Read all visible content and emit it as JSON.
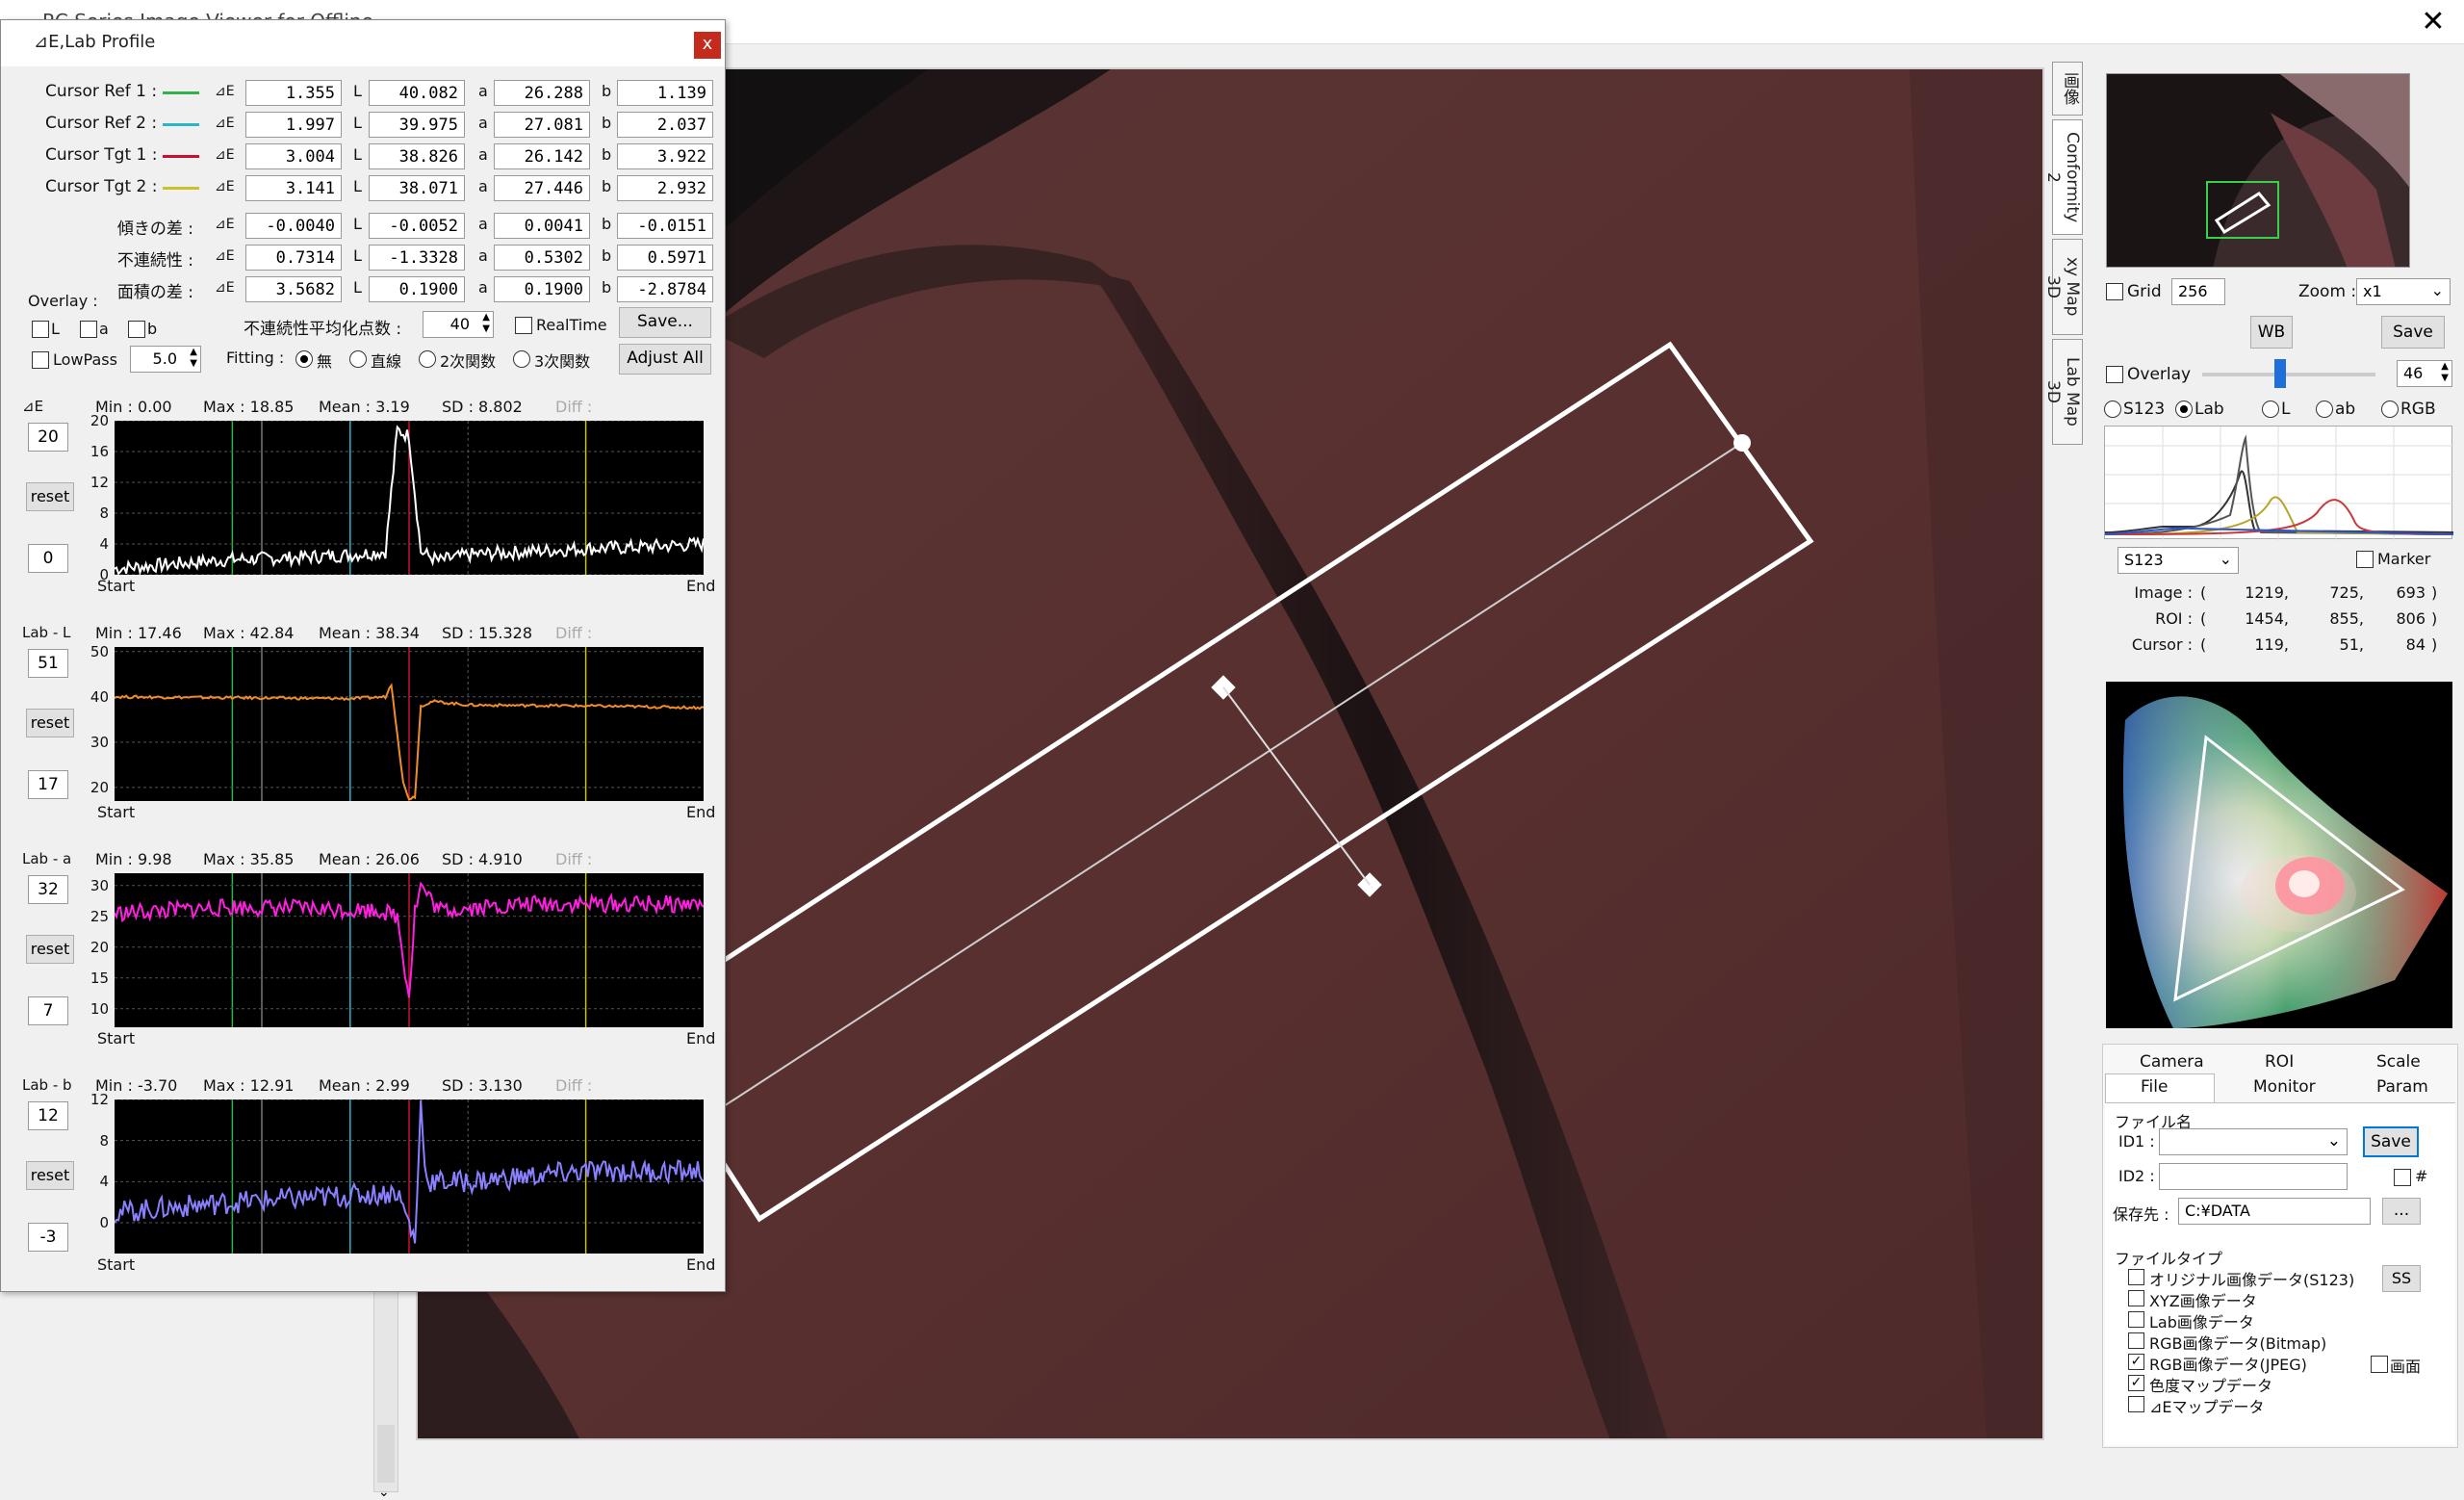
{
  "app": {
    "title": "RC Series Image Viewer for Offline ..."
  },
  "profile": {
    "title": "⊿E,Lab Profile",
    "close_label": "x",
    "cursors": [
      {
        "label": "Cursor Ref 1 :",
        "color": "#2fb24a",
        "dE_label": "⊿E",
        "dE": "1.355",
        "L": "40.082",
        "a": "26.288",
        "b": "1.139"
      },
      {
        "label": "Cursor Ref 2 :",
        "color": "#2bb5c8",
        "dE_label": "⊿E",
        "dE": "1.997",
        "L": "39.975",
        "a": "27.081",
        "b": "2.037"
      },
      {
        "label": "Cursor Tgt 1 :",
        "color": "#c8102e",
        "dE_label": "⊿E",
        "dE": "3.004",
        "L": "38.826",
        "a": "26.142",
        "b": "3.922"
      },
      {
        "label": "Cursor Tgt 2 :",
        "color": "#c9c227",
        "dE_label": "⊿E",
        "dE": "3.141",
        "L": "38.071",
        "a": "27.446",
        "b": "2.932"
      }
    ],
    "diffs": [
      {
        "label": "傾きの差 :",
        "dE_label": "⊿E",
        "dE": "-0.0040",
        "L": "-0.0052",
        "a": "0.0041",
        "b": "-0.0151"
      },
      {
        "label": "不連続性 :",
        "dE_label": "⊿E",
        "dE": "0.7314",
        "L": "-1.3328",
        "a": "0.5302",
        "b": "0.5971"
      },
      {
        "label": "面積の差 :",
        "dE_label": "⊿E",
        "dE": "3.5682",
        "L": "0.1900",
        "a": "0.1900",
        "b": "-2.8784"
      }
    ],
    "col_labels": {
      "L": "L",
      "a": "a",
      "b": "b"
    },
    "overlay_label": "Overlay :",
    "overlay_opts": [
      "L",
      "a",
      "b"
    ],
    "avg_label": "不連続性平均化点数 :",
    "avg_value": "40",
    "realtime_label": "RealTime",
    "save_label": "Save...",
    "lowpass_label": "LowPass",
    "lowpass_value": "5.0",
    "fitting_label": "Fitting :",
    "fitting_opts": [
      "無",
      "直線",
      "2次関数",
      "3次関数"
    ],
    "adjust_label": "Adjust All",
    "reset_label": "reset",
    "start_label": "Start",
    "end_label": "End",
    "diff_label": "Diff :"
  },
  "chart_data": [
    {
      "type": "line",
      "title": "⊿E",
      "ylim": [
        0,
        20
      ],
      "yticks": [
        "20",
        "16",
        "12",
        "8",
        "4",
        "0"
      ],
      "scale_max": "20",
      "scale_min": "0",
      "color": "#ffffff",
      "stats": {
        "min": "Min :  0.00",
        "max": "Max :  18.85",
        "mean": "Mean :  3.19",
        "sd": "SD :  8.802"
      },
      "x": [
        0,
        0.1,
        0.2,
        0.3,
        0.4,
        0.46,
        0.48,
        0.5,
        0.52,
        0.55,
        0.6,
        0.7,
        0.8,
        0.9,
        1.0
      ],
      "y": [
        0.8,
        1.4,
        2.0,
        2.2,
        2.6,
        3.0,
        18.8,
        18.0,
        3.0,
        1.8,
        2.6,
        3.0,
        3.4,
        3.6,
        4.0
      ],
      "noise": 0.9
    },
    {
      "type": "line",
      "title": "Lab - L",
      "ylim": [
        17,
        51
      ],
      "yticks": [
        "50",
        "40",
        "30",
        "20"
      ],
      "scale_max": "51",
      "scale_min": "17",
      "color": "#f08c2a",
      "stats": {
        "min": "Min :  17.46",
        "max": "Max :  42.84",
        "mean": "Mean :  38.34",
        "sd": "SD :  15.328"
      },
      "x": [
        0,
        0.2,
        0.4,
        0.46,
        0.47,
        0.49,
        0.5,
        0.51,
        0.52,
        0.54,
        0.6,
        0.8,
        1.0
      ],
      "y": [
        40,
        39.8,
        39.6,
        40,
        42.8,
        21,
        17.5,
        18,
        38,
        39,
        38.2,
        38,
        37.6
      ],
      "noise": 0.3
    },
    {
      "type": "line",
      "title": "Lab - a",
      "ylim": [
        7,
        32
      ],
      "yticks": [
        "30",
        "25",
        "20",
        "15",
        "10"
      ],
      "scale_max": "32",
      "scale_min": "7",
      "color": "#ff1fe0",
      "stats": {
        "min": "Min :  9.98",
        "max": "Max :  35.85",
        "mean": "Mean :  26.06",
        "sd": "SD :  4.910"
      },
      "x": [
        0,
        0.2,
        0.45,
        0.48,
        0.5,
        0.51,
        0.52,
        0.55,
        0.7,
        1.0
      ],
      "y": [
        25.5,
        26.5,
        26,
        25,
        12,
        26,
        30,
        26,
        27,
        27
      ],
      "noise": 1.4
    },
    {
      "type": "line",
      "title": "Lab - b",
      "ylim": [
        -3,
        12
      ],
      "yticks": [
        "12",
        "8",
        "4",
        "0"
      ],
      "scale_max": "12",
      "scale_min": "-3",
      "color": "#8a80ff",
      "stats": {
        "min": "Min :  -3.70",
        "max": "Max :  12.91",
        "mean": "Mean :  2.99",
        "sd": "SD :  3.130"
      },
      "x": [
        0,
        0.2,
        0.45,
        0.48,
        0.5,
        0.51,
        0.52,
        0.53,
        0.6,
        0.8,
        1.0
      ],
      "y": [
        1,
        2,
        2.8,
        3,
        0,
        -2,
        11.5,
        4,
        4,
        5,
        5
      ],
      "noise": 1.1
    }
  ],
  "right": {
    "grid_label": "Grid",
    "grid_value": "256",
    "zoom_label": "Zoom :",
    "zoom_value": "x1",
    "wb_label": "WB",
    "save_label": "Save",
    "overlay_label": "Overlay",
    "overlay_value": "46",
    "overlay_level": 0.45,
    "modes": [
      "S123",
      "Lab",
      "L",
      "ab",
      "RGB"
    ],
    "marker_label": "Marker",
    "space_select": "S123",
    "rows": [
      {
        "label": "Image :",
        "open": "(",
        "v1": "1219,",
        "v2": "725,",
        "v3": "693",
        "close": ")"
      },
      {
        "label": "ROI :",
        "open": "(",
        "v1": "1454,",
        "v2": "855,",
        "v3": "806",
        "close": ")"
      },
      {
        "label": "Cursor :",
        "open": "(",
        "v1": "119,",
        "v2": "51,",
        "v3": "84",
        "close": ")"
      }
    ],
    "tabs_top": [
      "Camera",
      "ROI",
      "Scale"
    ],
    "tabs_bottom": [
      "File",
      "Monitor",
      "Param"
    ],
    "filename_group": "ファイル名",
    "id1_label": "ID1 :",
    "id2_label": "ID2 :",
    "file_save_label": "Save",
    "hash_label": "#",
    "dest_label": "保存先 :",
    "dest_value": "C:¥DATA",
    "browse_label": "...",
    "filetype_group": "ファイルタイプ",
    "ss_label": "SS",
    "screen_label": "画面",
    "filetypes": [
      {
        "label": "オリジナル画像データ(S123)",
        "checked": false
      },
      {
        "label": "XYZ画像データ",
        "checked": false
      },
      {
        "label": "Lab画像データ",
        "checked": false
      },
      {
        "label": "RGB画像データ(Bitmap)",
        "checked": false
      },
      {
        "label": "RGB画像データ(JPEG)",
        "checked": true
      },
      {
        "label": "色度マップデータ",
        "checked": true
      },
      {
        "label": "⊿Eマップデータ",
        "checked": false
      }
    ]
  },
  "side_tabs": [
    "画像",
    "Conformity 2",
    "xy Map 3D",
    "Lab Map 3D"
  ]
}
